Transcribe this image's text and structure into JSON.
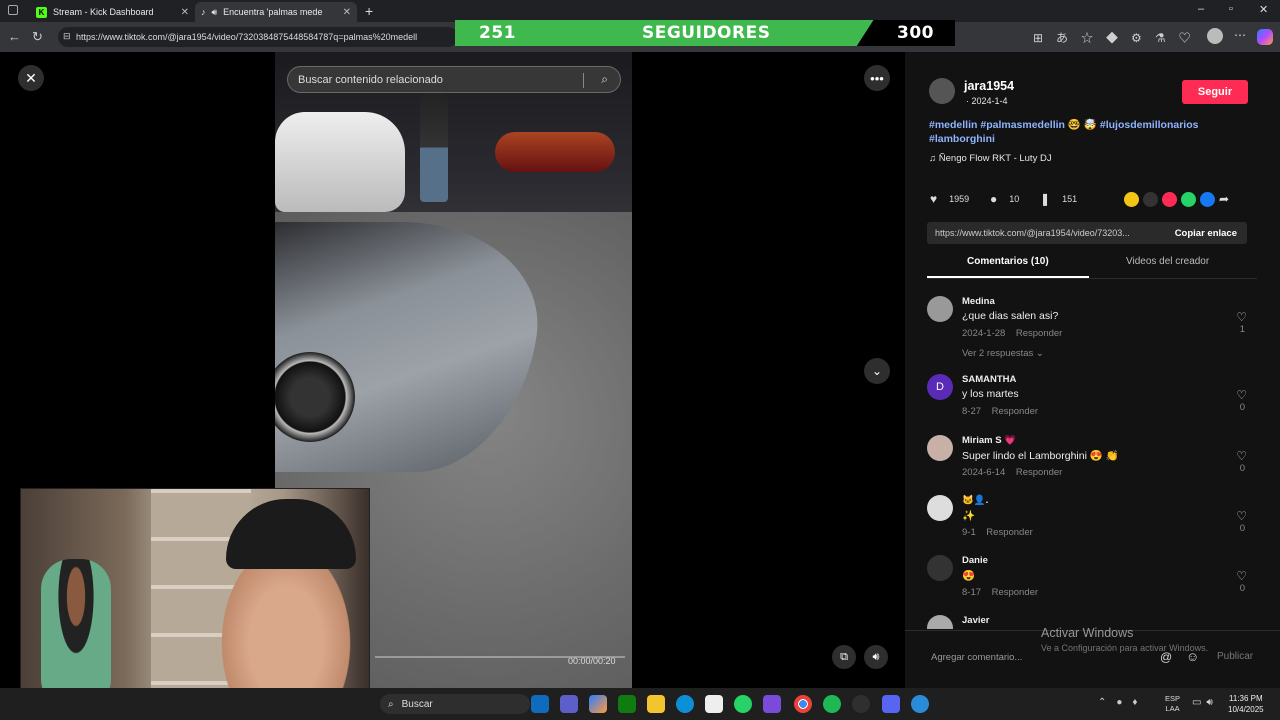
{
  "browser": {
    "tabs": [
      {
        "label": "Stream - Kick Dashboard",
        "active": false
      },
      {
        "label": "Encuentra 'palmas medellín'",
        "active": true
      }
    ],
    "url": "https://www.tiktok.com/@jara1954/video/7320384875448584787q=palmas%20medell"
  },
  "follow_goal": {
    "current": "251",
    "label": "SEGUIDORES",
    "target": "300",
    "progress": 0.837
  },
  "player": {
    "search_placeholder": "Buscar contenido relacionado",
    "time": "00:00/00:20"
  },
  "post": {
    "username": "jara1954",
    "date": "· 2024-1-4",
    "follow_label": "Seguir",
    "caption_line1": "#medellin #palmasmedellin 🤓 🤯 #lujosdemillonarios",
    "caption_line2": "#lamborghini",
    "music": "Ñengo Flow RKT - Luty DJ",
    "likes": "1959",
    "comments": "10",
    "saves": "151",
    "link": "https://www.tiktok.com/@jara1954/video/73203...",
    "copy_label": "Copiar enlace",
    "tab_comments": "Comentarios (10)",
    "tab_videos": "Videos del creador",
    "add_comment": "Agregar comentario...",
    "publish": "Publicar"
  },
  "comments": [
    {
      "name": "Medina",
      "text": "¿que dias salen asi?",
      "date": "2024-1-28",
      "reply": "Responder",
      "likes": "1",
      "extra": "Ver 2 respuestas ⌄"
    },
    {
      "name": "SAMANTHA",
      "text": "y los martes",
      "date": "8-27",
      "reply": "Responder",
      "likes": "0",
      "initial": "D"
    },
    {
      "name": "Miriam S 💗",
      "text": "Super lindo el Lamborghini 😍 👏",
      "date": "2024-6-14",
      "reply": "Responder",
      "likes": "0"
    },
    {
      "name": "🐱‍👤.",
      "text": "✨",
      "date": "9-1",
      "reply": "Responder",
      "likes": "0"
    },
    {
      "name": "Danie",
      "text": "😍",
      "date": "8-17",
      "reply": "Responder",
      "likes": "0"
    },
    {
      "name": "Javier",
      "text": "",
      "date": "",
      "reply": "",
      "likes": ""
    }
  ],
  "watermark": {
    "line1": "Activar Windows",
    "line2": "Ve a Configuración para activar Windows."
  },
  "taskbar": {
    "search": "Buscar",
    "lang1": "ESP",
    "lang2": "LAA",
    "time": "11:36 PM",
    "date": "10/4/2025"
  },
  "colors": {
    "accent": "#fe2c55",
    "goal_green": "#3fb94d",
    "tag_blue": "#8fb4ff"
  }
}
